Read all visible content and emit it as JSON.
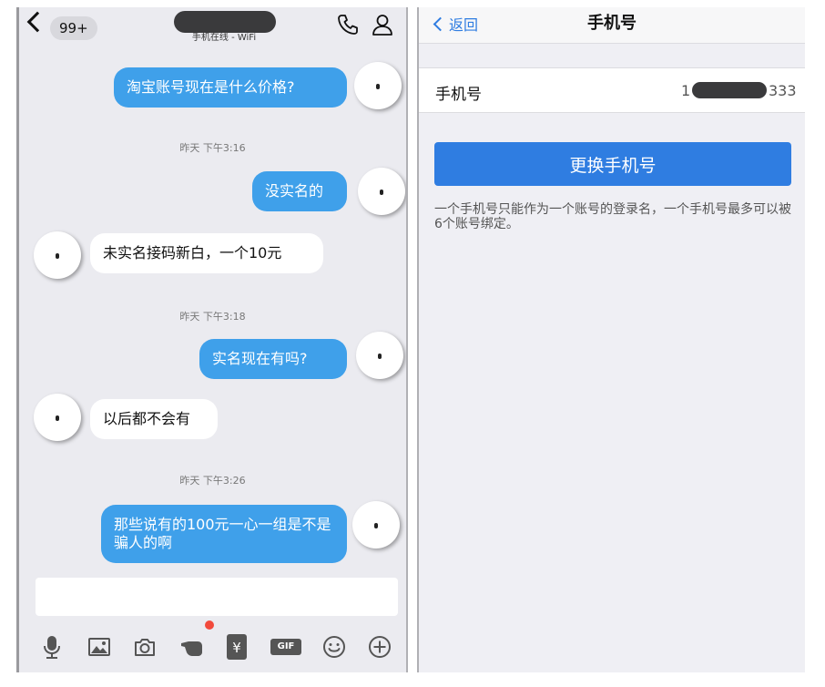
{
  "chat": {
    "header": {
      "unread_count": "99+",
      "contact_status": "手机在线 - WiFi"
    },
    "messages": [
      {
        "direction": "out",
        "text": "淘宝账号现在是什么价格?"
      },
      {
        "type": "timestamp",
        "text": "昨天 下午3:16"
      },
      {
        "direction": "out",
        "text": "没实名的"
      },
      {
        "direction": "in",
        "text": "未实名接码新白，一个10元"
      },
      {
        "type": "timestamp",
        "text": "昨天 下午3:18"
      },
      {
        "direction": "out",
        "text": "实名现在有吗?"
      },
      {
        "direction": "in",
        "text": "以后都不会有"
      },
      {
        "type": "timestamp",
        "text": "昨天 下午3:26"
      },
      {
        "direction": "out",
        "text": "那些说有的100元一心一组是不是骗人的啊"
      }
    ],
    "input": {
      "value": "",
      "placeholder": ""
    },
    "toolbar": {
      "icons": [
        "microphone-icon",
        "image-icon",
        "camera-icon",
        "hand-icon",
        "red-packet-icon",
        "gif-icon",
        "emoji-icon",
        "plus-icon"
      ],
      "red_packet_glyph": "¥",
      "gif_label": "GIF"
    }
  },
  "settings": {
    "nav": {
      "back_label": "返回",
      "title": "手机号"
    },
    "phone_row": {
      "label": "手机号",
      "value_prefix": "1",
      "value_suffix": "333"
    },
    "change_button_label": "更换手机号",
    "hint": "一个手机号只能作为一个账号的登录名，一个手机号最多可以被6个账号绑定。"
  },
  "colors": {
    "outgoing_bubble": "#3fa0ea",
    "incoming_bubble": "#ffffff",
    "chat_background": "#ebebf0",
    "primary_button": "#2f7de1",
    "link_blue": "#2f7de1",
    "notification_dot": "#f24a3c"
  }
}
